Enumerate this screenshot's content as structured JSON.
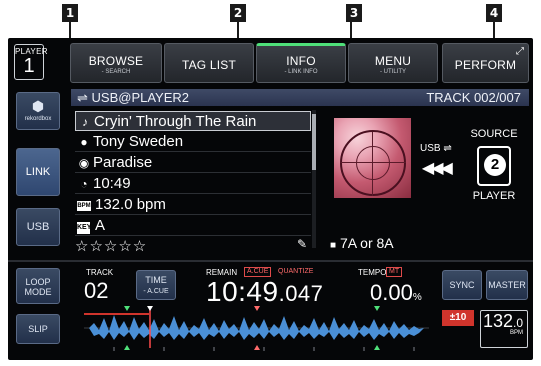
{
  "callouts": [
    "1",
    "2",
    "3",
    "4"
  ],
  "player": {
    "label": "PLAYER",
    "number": "1"
  },
  "top_buttons": [
    {
      "main": "BROWSE",
      "sub": "- SEARCH"
    },
    {
      "main": "TAG LIST",
      "sub": ""
    },
    {
      "main": "INFO",
      "sub": "- LINK INFO"
    },
    {
      "main": "MENU",
      "sub": "- UTILITY"
    },
    {
      "main": "PERFORM",
      "sub": ""
    }
  ],
  "side_buttons": {
    "rekordbox": "rekordbox",
    "link": "LINK",
    "usb": "USB"
  },
  "path": {
    "source": "USB@PLAYER2",
    "track": "TRACK 002/007"
  },
  "track_info": {
    "title": "Cryin' Through The Rain",
    "artist": "Tony Sweden",
    "album": "Paradise",
    "time": "10:49",
    "bpm_icon": "BPM",
    "bpm": "132.0 bpm",
    "key_icon": "KEY",
    "key": "A",
    "rating": "☆☆☆☆☆"
  },
  "usb_transfer": {
    "label": "USB ⇌",
    "arrows": "◀◀◀"
  },
  "source": {
    "label": "SOURCE",
    "number": "2",
    "player": "PLAYER"
  },
  "key_suggestion": "7A or 8A",
  "bottom": {
    "loop_mode": "LOOP\nMODE",
    "slip": "SLIP",
    "track_label": "TRACK",
    "track_no": "02",
    "time_mode": "TIME",
    "acue": "- A.CUE",
    "remain_label": "REMAIN",
    "acue_tag": "A.CUE",
    "quantize": "QUANTIZE",
    "time_big": "10:49",
    "time_ms": ".047",
    "tempo_label": "TEMPO",
    "mt_tag": "MT",
    "tempo_val": "0.00",
    "tempo_unit": "%",
    "sync": "SYNC",
    "master": "MASTER",
    "range": "±10",
    "bpm_big": "132",
    "bpm_dec": ".0",
    "bpm_unit": "BPM"
  },
  "colors": {
    "screen_bg": "#050608",
    "path_bar": "#3f4a66",
    "waveform": "#4a8fd6",
    "accent_red": "#d0342c",
    "info_tab_accent": "#4fe07a"
  }
}
